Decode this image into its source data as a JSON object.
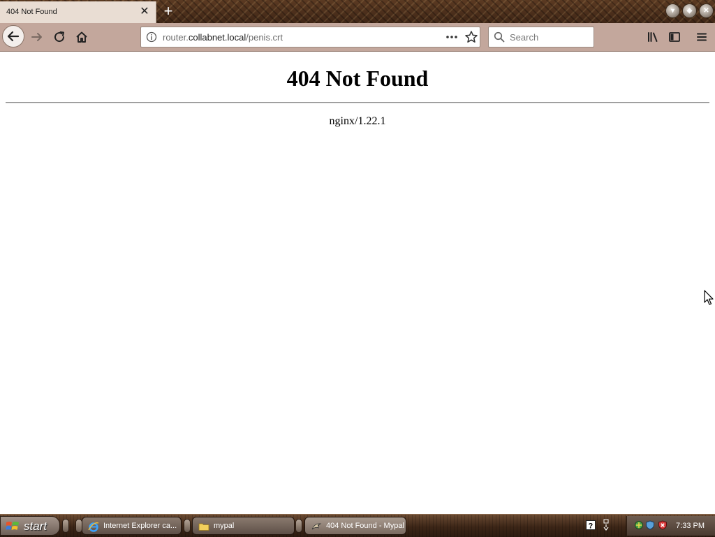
{
  "tab": {
    "title": "404 Not Found",
    "close_icon": "close-icon"
  },
  "toolbar": {
    "back_icon": "back-arrow-icon",
    "forward_icon": "forward-arrow-icon",
    "reload_icon": "reload-icon",
    "home_icon": "home-icon",
    "library_icon": "library-icon",
    "sidebar_icon": "sidebar-icon",
    "menu_icon": "hamburger-menu-icon"
  },
  "url": {
    "prefix": "router.",
    "domain": "collabnet.local",
    "path": "/penis.crt"
  },
  "search": {
    "placeholder": "Search"
  },
  "page": {
    "heading": "404 Not Found",
    "server": "nginx/1.22.1"
  },
  "taskbar": {
    "start_label": "start",
    "tasks": [
      {
        "label": "Internet Explorer ca...",
        "icon": "internet-explorer-icon"
      },
      {
        "label": "mypal",
        "icon": "folder-icon"
      },
      {
        "label": "404 Not Found - Mypal",
        "icon": "mypal-browser-icon"
      }
    ],
    "clock": "7:33 PM"
  },
  "colors": {
    "tabstrip": "#4a2f1c",
    "navbar": "#c3a79c",
    "active_tab": "#e9ddd3",
    "taskbar": "#3c2617"
  }
}
